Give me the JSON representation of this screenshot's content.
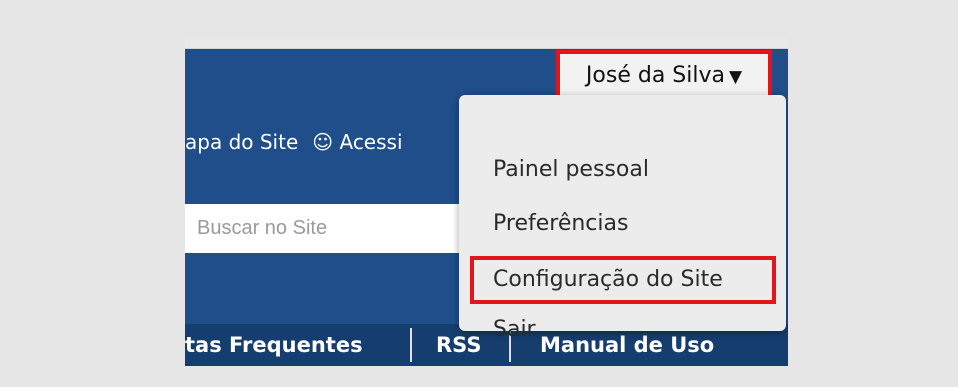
{
  "user_menu": {
    "name": "José da Silva",
    "caret": "▼"
  },
  "top_links": {
    "site_map": "apa do Site",
    "accessibility_icon": "☺",
    "accessibility": "Acessi"
  },
  "search": {
    "placeholder": "Buscar no Site"
  },
  "dropdown": {
    "items": [
      {
        "label": "Painel pessoal"
      },
      {
        "label": "Preferências"
      },
      {
        "label": "Configuração do Site"
      },
      {
        "label": "Sair"
      }
    ]
  },
  "bottom_nav": {
    "items": [
      {
        "label": "tas Frequentes"
      },
      {
        "label": "RSS"
      },
      {
        "label": "Manual de Uso"
      }
    ],
    "separator": "|"
  },
  "colors": {
    "header_blue": "#1f4e8a",
    "nav_blue": "#163d6f",
    "highlight_red": "#e2141c",
    "page_bg": "#e6e6e7"
  }
}
